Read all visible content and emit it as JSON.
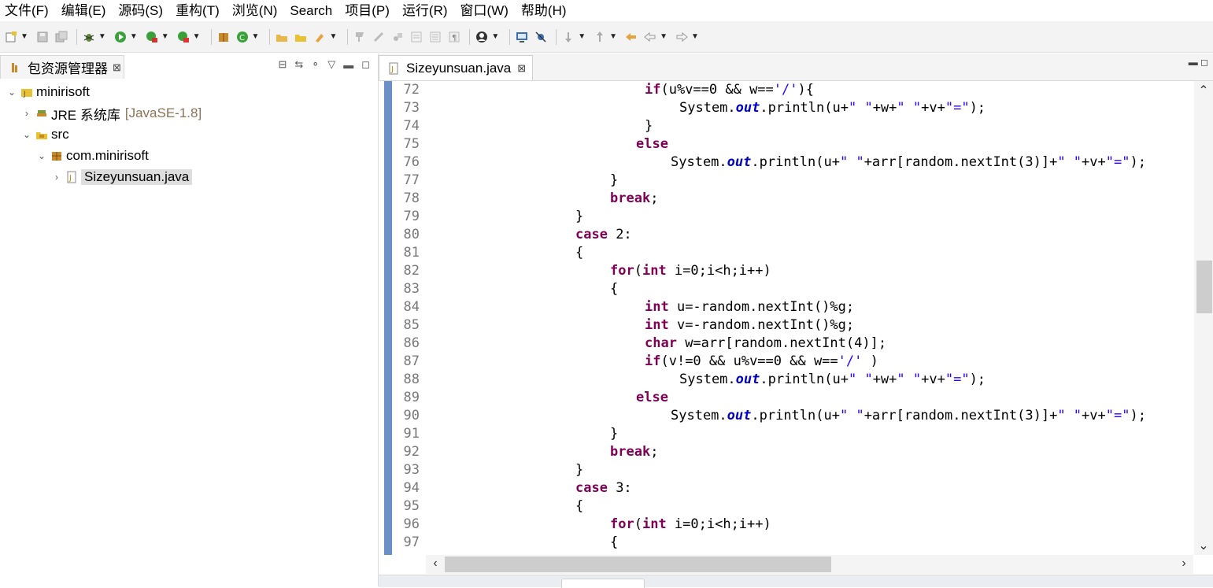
{
  "menu": [
    {
      "label": "文件(F)"
    },
    {
      "label": "编辑(E)"
    },
    {
      "label": "源码(S)"
    },
    {
      "label": "重构(T)"
    },
    {
      "label": "浏览(N)"
    },
    {
      "label": "Search"
    },
    {
      "label": "项目(P)"
    },
    {
      "label": "运行(R)"
    },
    {
      "label": "窗口(W)"
    },
    {
      "label": "帮助(H)"
    }
  ],
  "left_view": {
    "tab_title": "包资源管理器",
    "close_glyph": "⊠",
    "tree": [
      {
        "label": "minirisoft",
        "decoration": "",
        "indent": 0,
        "expanded": true,
        "icon": "java-project-icon"
      },
      {
        "label": "JRE 系统库",
        "decoration": "[JavaSE-1.8]",
        "indent": 1,
        "expanded": false,
        "icon": "library-icon"
      },
      {
        "label": "src",
        "decoration": "",
        "indent": 1,
        "expanded": true,
        "icon": "source-folder-icon"
      },
      {
        "label": "com.minirisoft",
        "decoration": "",
        "indent": 2,
        "expanded": true,
        "icon": "package-icon"
      },
      {
        "label": "Sizeyunsuan.java",
        "decoration": "",
        "indent": 3,
        "expanded": false,
        "icon": "java-file-icon",
        "selected": true
      }
    ]
  },
  "editor": {
    "tab_title": "Sizeyunsuan.java",
    "close_glyph": "⊠",
    "scroll": {
      "vertical_position": 0.42,
      "vertical_visible": 0.12,
      "horizontal_position": 0.0,
      "horizontal_visible": 0.53
    },
    "lines": [
      {
        "n": "72",
        "indent": 3,
        "t": [
          [
            "kw",
            "if"
          ],
          [
            "p",
            "(u%v==0 && w=="
          ],
          [
            "st",
            "'/'"
          ],
          [
            "p",
            "){"
          ]
        ]
      },
      {
        "n": "73",
        "indent": 4,
        "t": [
          [
            "p",
            "System."
          ],
          [
            "fld",
            "out"
          ],
          [
            "p",
            ".println(u+"
          ],
          [
            "st",
            "\" \""
          ],
          [
            "p",
            "+w+"
          ],
          [
            "st",
            "\" \""
          ],
          [
            "p",
            "+v+"
          ],
          [
            "st",
            "\"=\""
          ],
          [
            "p",
            ");"
          ]
        ]
      },
      {
        "n": "74",
        "indent": 3,
        "t": [
          [
            "p",
            "}"
          ]
        ]
      },
      {
        "n": "75",
        "indent": 2.75,
        "t": [
          [
            "kw",
            "else"
          ]
        ]
      },
      {
        "n": "76",
        "indent": 3.75,
        "t": [
          [
            "p",
            "System."
          ],
          [
            "fld",
            "out"
          ],
          [
            "p",
            ".println(u+"
          ],
          [
            "st",
            "\" \""
          ],
          [
            "p",
            "+arr[random.nextInt(3)]+"
          ],
          [
            "st",
            "\" \""
          ],
          [
            "p",
            "+v+"
          ],
          [
            "st",
            "\"=\""
          ],
          [
            "p",
            ");"
          ]
        ]
      },
      {
        "n": "77",
        "indent": 2,
        "t": [
          [
            "p",
            "}"
          ]
        ]
      },
      {
        "n": "78",
        "indent": 2,
        "t": [
          [
            "kw",
            "break"
          ],
          [
            "p",
            ";"
          ]
        ]
      },
      {
        "n": "79",
        "indent": 1,
        "t": [
          [
            "p",
            "}"
          ]
        ]
      },
      {
        "n": "80",
        "indent": 1,
        "t": [
          [
            "kw",
            "case"
          ],
          [
            "p",
            " 2:"
          ]
        ]
      },
      {
        "n": "81",
        "indent": 1,
        "t": [
          [
            "p",
            "{"
          ]
        ]
      },
      {
        "n": "82",
        "indent": 2,
        "t": [
          [
            "kw",
            "for"
          ],
          [
            "p",
            "("
          ],
          [
            "kw",
            "int"
          ],
          [
            "p",
            " i=0;i<h;i++)"
          ]
        ]
      },
      {
        "n": "83",
        "indent": 2,
        "t": [
          [
            "p",
            "{"
          ]
        ]
      },
      {
        "n": "84",
        "indent": 3,
        "t": [
          [
            "kw",
            "int"
          ],
          [
            "p",
            " u=-random.nextInt()%g;"
          ]
        ]
      },
      {
        "n": "85",
        "indent": 3,
        "t": [
          [
            "kw",
            "int"
          ],
          [
            "p",
            " v=-random.nextInt()%g;"
          ]
        ]
      },
      {
        "n": "86",
        "indent": 3,
        "t": [
          [
            "kw",
            "char"
          ],
          [
            "p",
            " w=arr[random.nextInt(4)];"
          ]
        ]
      },
      {
        "n": "87",
        "indent": 3,
        "t": [
          [
            "kw",
            "if"
          ],
          [
            "p",
            "(v!=0 && u%v==0 && w=="
          ],
          [
            "st",
            "'/'"
          ],
          [
            "p",
            " )"
          ]
        ]
      },
      {
        "n": "88",
        "indent": 4,
        "t": [
          [
            "p",
            "System."
          ],
          [
            "fld",
            "out"
          ],
          [
            "p",
            ".println(u+"
          ],
          [
            "st",
            "\" \""
          ],
          [
            "p",
            "+w+"
          ],
          [
            "st",
            "\" \""
          ],
          [
            "p",
            "+v+"
          ],
          [
            "st",
            "\"=\""
          ],
          [
            "p",
            ");"
          ]
        ]
      },
      {
        "n": "89",
        "indent": 2.75,
        "t": [
          [
            "kw",
            "else"
          ]
        ]
      },
      {
        "n": "90",
        "indent": 3.75,
        "t": [
          [
            "p",
            "System."
          ],
          [
            "fld",
            "out"
          ],
          [
            "p",
            ".println(u+"
          ],
          [
            "st",
            "\" \""
          ],
          [
            "p",
            "+arr[random.nextInt(3)]+"
          ],
          [
            "st",
            "\" \""
          ],
          [
            "p",
            "+v+"
          ],
          [
            "st",
            "\"=\""
          ],
          [
            "p",
            ");"
          ]
        ]
      },
      {
        "n": "91",
        "indent": 2,
        "t": [
          [
            "p",
            "}"
          ]
        ]
      },
      {
        "n": "92",
        "indent": 2,
        "t": [
          [
            "kw",
            "break"
          ],
          [
            "p",
            ";"
          ]
        ]
      },
      {
        "n": "93",
        "indent": 1,
        "t": [
          [
            "p",
            "}"
          ]
        ]
      },
      {
        "n": "94",
        "indent": 1,
        "t": [
          [
            "kw",
            "case"
          ],
          [
            "p",
            " 3:"
          ]
        ]
      },
      {
        "n": "95",
        "indent": 1,
        "t": [
          [
            "p",
            "{"
          ]
        ]
      },
      {
        "n": "96",
        "indent": 2,
        "t": [
          [
            "kw",
            "for"
          ],
          [
            "p",
            "("
          ],
          [
            "kw",
            "int"
          ],
          [
            "p",
            " i=0;i<h;i++)"
          ]
        ]
      },
      {
        "n": "97",
        "indent": 2,
        "t": [
          [
            "p",
            "{"
          ]
        ]
      }
    ]
  },
  "colors": {
    "keyword": "#7f0055",
    "string": "#2a00ff",
    "field": "#0000c0",
    "ruler": "#6b8fc7"
  }
}
